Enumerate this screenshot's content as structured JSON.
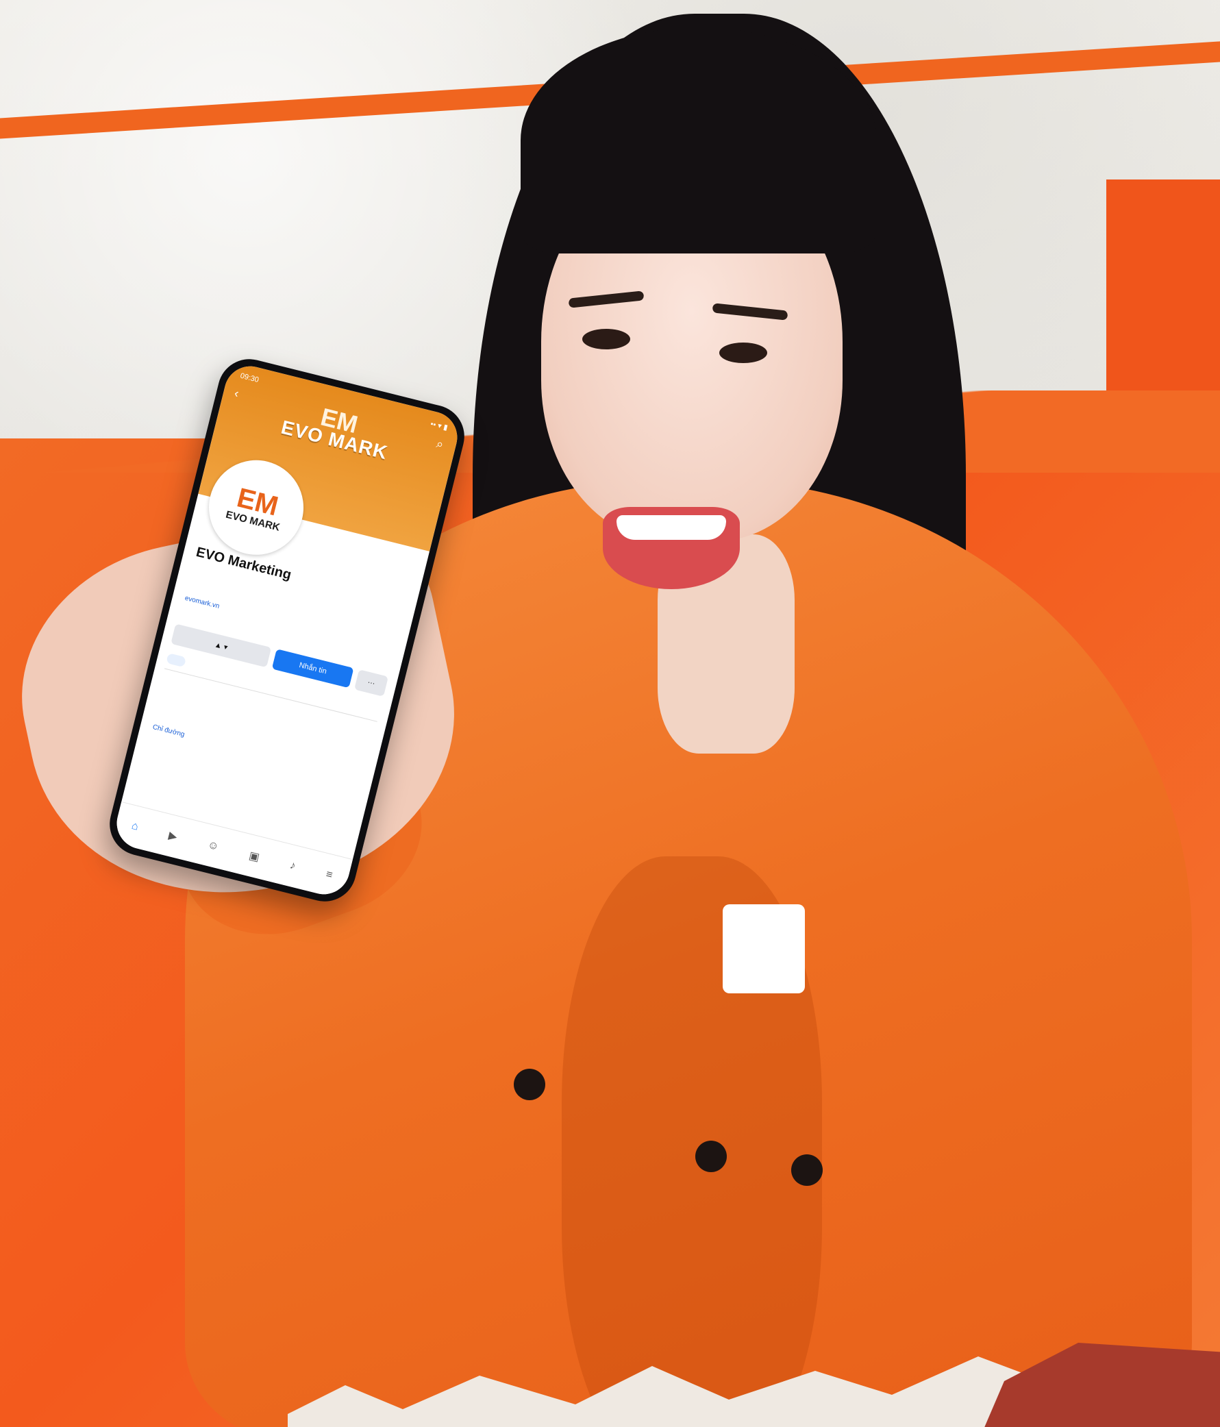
{
  "phone": {
    "status_time": "09:30",
    "status_icons": "▪▪ ▾ ▮",
    "cover": {
      "logo_mark": "EM",
      "brand": "EVO MARK"
    },
    "avatar": {
      "logo_mark": "EM",
      "brand": "EVO MARK"
    },
    "page_name": "EVO Marketing",
    "website": "evomark.vn",
    "buttons": {
      "message": "Nhắn tin",
      "more": "···"
    },
    "contact_line": "Chỉ đường"
  },
  "colors": {
    "brand_orange": "#f0651f",
    "facebook_blue": "#1877f2"
  },
  "icons": [
    "back-icon",
    "search-icon",
    "home-icon",
    "video-icon",
    "friends-icon",
    "marketplace-icon",
    "notifications-icon",
    "menu-icon"
  ]
}
